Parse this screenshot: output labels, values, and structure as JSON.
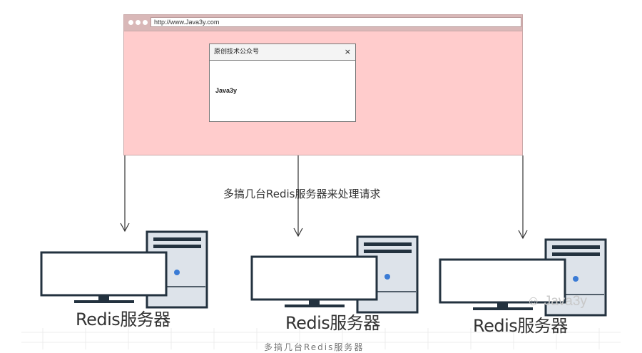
{
  "browser": {
    "url": "http://www.Java3y.com",
    "dialog_title": "原创技术公众号",
    "dialog_close": "×",
    "dialog_body": "Java3y"
  },
  "caption": "多搞几台Redis服务器来处理请求",
  "servers": [
    {
      "label": "Redis服务器"
    },
    {
      "label": "Redis服务器"
    },
    {
      "label": "Redis服务器"
    }
  ],
  "bottom_caption": "多搞几台Redis服务器",
  "watermark": "Java3y",
  "colors": {
    "browser_bg": "#ffcccc",
    "screen_dark": "#23323f",
    "tower_light": "#dde3ea",
    "power_led": "#3a7bd5"
  }
}
